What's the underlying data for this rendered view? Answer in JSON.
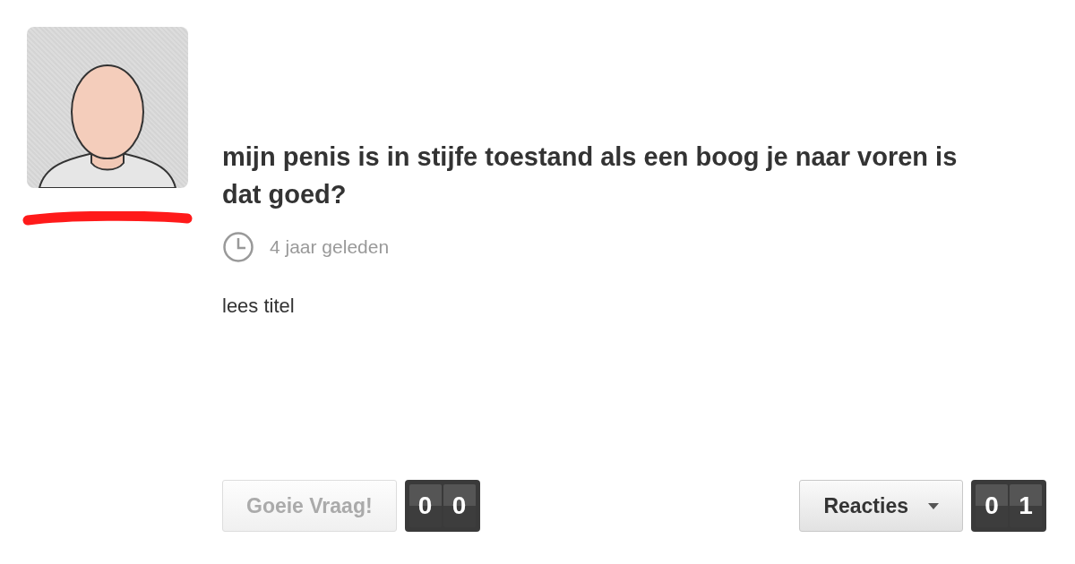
{
  "question": {
    "title": "mijn penis is in stijfe toestand als een boog je naar voren is dat goed?",
    "time": "4 jaar geleden",
    "body": "lees titel"
  },
  "author": {
    "redacted": true
  },
  "actions": [
    {
      "kind": "vote",
      "label": "Goeie Vraag!",
      "disabled": true,
      "count": [
        "0",
        "0"
      ]
    },
    {
      "kind": "menu",
      "label": "Reacties",
      "disabled": false,
      "count": [
        "0",
        "1"
      ]
    }
  ]
}
